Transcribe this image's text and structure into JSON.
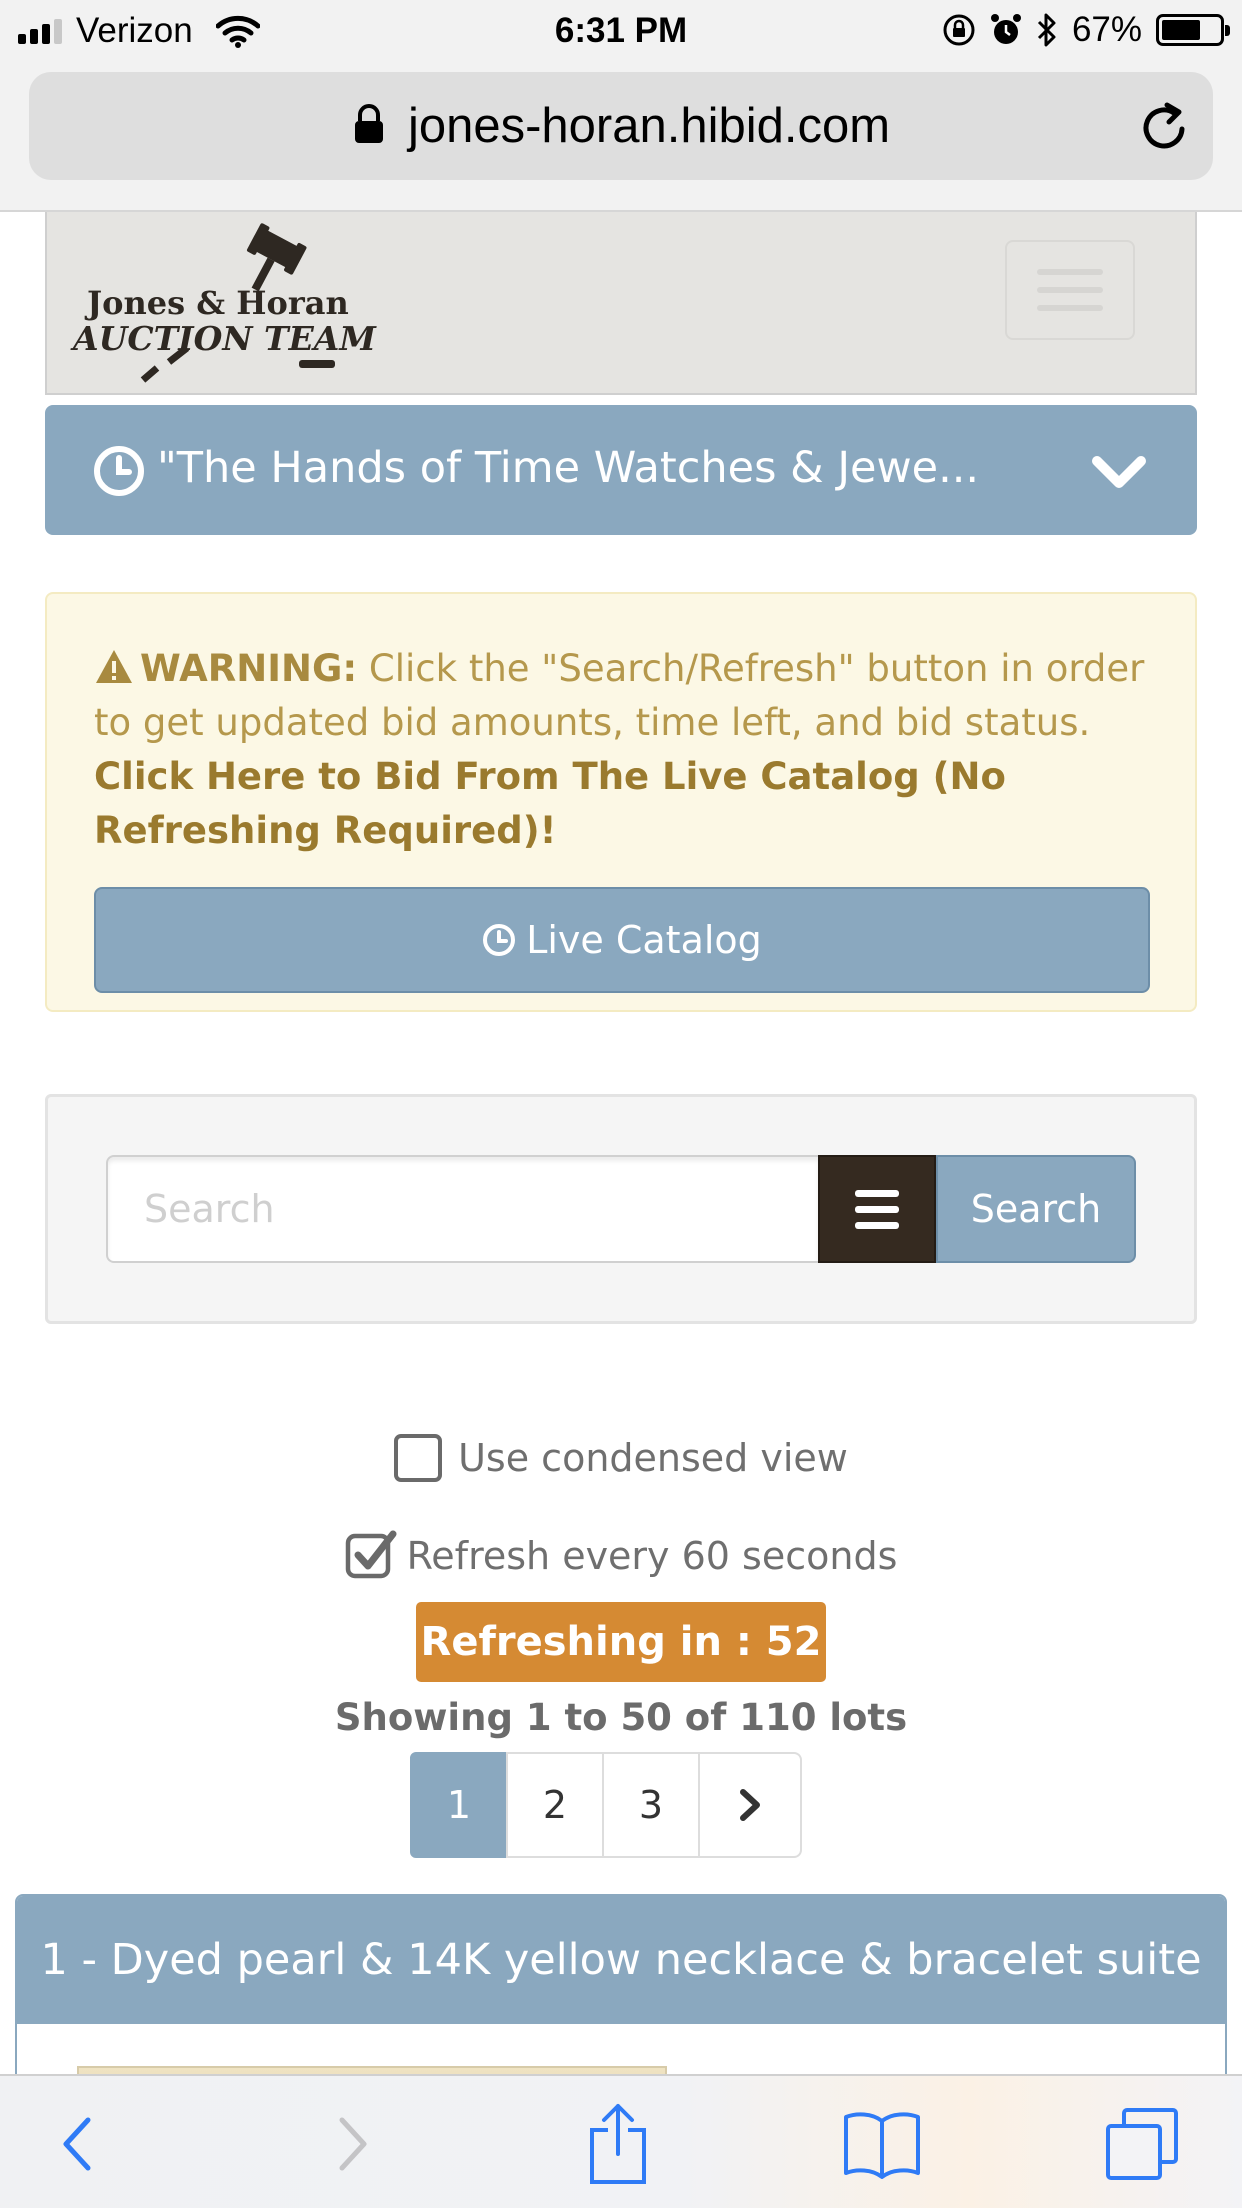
{
  "status_bar": {
    "carrier": "Verizon",
    "time": "6:31 PM",
    "battery_percent": "67%",
    "battery_level": 0.67,
    "icons": [
      "signal-icon",
      "wifi-icon",
      "orientation-lock-icon",
      "alarm-icon",
      "bluetooth-icon",
      "battery-icon"
    ]
  },
  "browser": {
    "url": "jones-horan.hibid.com",
    "lock_icon": "lock-icon",
    "reload_icon": "reload-icon"
  },
  "header": {
    "logo_line1": "Jones & Horan",
    "logo_line2": "AUCTION TEAM",
    "menu_icon": "hamburger-icon"
  },
  "auction_bar": {
    "title": "\"The Hands of Time Watches & Jewe...",
    "icon": "clock-icon",
    "toggle_icon": "chevron-down-icon"
  },
  "warning": {
    "label": "WARNING:",
    "text": " Click the \"Search/Refresh\" button in order to get updated bid amounts, time left, and bid status.",
    "link": "Click Here to Bid From The Live Catalog (No Refreshing Required)!",
    "button_label": "Live Catalog"
  },
  "search": {
    "placeholder": "Search",
    "value": "",
    "button_label": "Search"
  },
  "options": {
    "condensed_label": "Use condensed view",
    "condensed_checked": false,
    "refresh_label": "Refresh every 60 seconds",
    "refresh_checked": true
  },
  "refresh_badge": "Refreshing in : 52",
  "showing": "Showing 1 to 50 of 110 lots",
  "pagination": {
    "pages": [
      "1",
      "2",
      "3"
    ],
    "current": "1",
    "next_icon": "chevron-right-icon"
  },
  "lot": {
    "title": "1 - Dyed pearl & 14K yellow necklace & bracelet suite"
  },
  "toolbar": {
    "items": [
      "back-icon",
      "forward-icon",
      "share-icon",
      "bookmarks-icon",
      "tabs-icon"
    ]
  },
  "colors": {
    "primary_blue": "#8aa8bf",
    "dark_brown": "#352a20",
    "orange": "#d58a33",
    "warning_bg": "#fcf8e5",
    "warning_text": "#b5984c",
    "ios_blue": "#2f7bf6"
  }
}
